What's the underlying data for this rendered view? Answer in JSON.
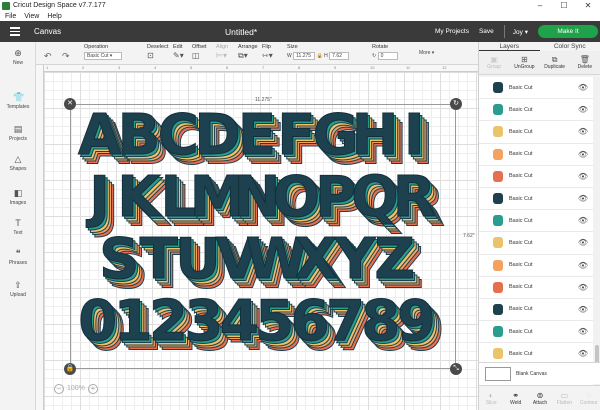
{
  "window": {
    "title": "Cricut Design Space  v7.7.177",
    "controls": [
      "–",
      "☐",
      "✕"
    ]
  },
  "menu": [
    "File",
    "View",
    "Help"
  ],
  "header": {
    "section": "Canvas",
    "doc_title": "Untitled*",
    "my_projects": "My Projects",
    "save": "Save",
    "user": "Joy",
    "user_chevron": "▾",
    "make_it": "Make It"
  },
  "toolbar": {
    "undo": "↶",
    "redo": "↷",
    "operation_label": "Operation",
    "operation_value": "Basic Cut",
    "deselect": "Deselect",
    "edit": "Edit",
    "offset": "Offset",
    "align": "Align",
    "arrange": "Arrange",
    "flip": "Flip",
    "size": "Size",
    "w_label": "W",
    "w_value": "11.275",
    "h_label": "H",
    "h_value": "7.62",
    "rotate": "Rotate",
    "rotate_value": "0",
    "more": "More"
  },
  "leftnav": [
    {
      "label": "New",
      "icon": "plus-icon",
      "glyph": "⊕"
    },
    {
      "label": "Templates",
      "icon": "shirt-icon",
      "glyph": "👕"
    },
    {
      "label": "Projects",
      "icon": "projects-icon",
      "glyph": "▤"
    },
    {
      "label": "Shapes",
      "icon": "shapes-icon",
      "glyph": "△"
    },
    {
      "label": "Images",
      "icon": "images-icon",
      "glyph": "◧"
    },
    {
      "label": "Text",
      "icon": "text-icon",
      "glyph": "T"
    },
    {
      "label": "Phrases",
      "icon": "phrases-icon",
      "glyph": "❝"
    },
    {
      "label": "Upload",
      "icon": "upload-icon",
      "glyph": "⇪"
    }
  ],
  "canvas": {
    "ruler_ticks": [
      "1",
      "2",
      "3",
      "4",
      "5",
      "6",
      "7",
      "8",
      "9",
      "10",
      "11",
      "12"
    ],
    "width_dim": "11.275\"",
    "height_dim": "7.62\"",
    "zoom": "100%",
    "rows": [
      "ABCDEFGHI",
      "JKLMNOPQR",
      "STUVWXYZ",
      "0123456789"
    ],
    "letter_color": "#1e4150",
    "shadow_colors": [
      "#2a9d8f",
      "#e9c46a",
      "#f4a261",
      "#e76f51"
    ]
  },
  "panel": {
    "tabs": [
      "Layers",
      "Color Sync"
    ],
    "tools": [
      {
        "label": "Group",
        "icon": "group-icon",
        "glyph": "▣",
        "enabled": false
      },
      {
        "label": "UnGroup",
        "icon": "ungroup-icon",
        "glyph": "⊞",
        "enabled": true
      },
      {
        "label": "Duplicate",
        "icon": "duplicate-icon",
        "glyph": "⧉",
        "enabled": true
      },
      {
        "label": "Delete",
        "icon": "trash-icon",
        "glyph": "🗑",
        "enabled": true
      }
    ],
    "layers": [
      {
        "name": "Basic Cut",
        "color": "#1e4150"
      },
      {
        "name": "Basic Cut",
        "color": "#2a9d8f"
      },
      {
        "name": "Basic Cut",
        "color": "#e9c46a"
      },
      {
        "name": "Basic Cut",
        "color": "#f4a261"
      },
      {
        "name": "Basic Cut",
        "color": "#e76f51"
      },
      {
        "name": "Basic Cut",
        "color": "#1e4150"
      },
      {
        "name": "Basic Cut",
        "color": "#2a9d8f"
      },
      {
        "name": "Basic Cut",
        "color": "#e9c46a"
      },
      {
        "name": "Basic Cut",
        "color": "#f4a261"
      },
      {
        "name": "Basic Cut",
        "color": "#e76f51"
      },
      {
        "name": "Basic Cut",
        "color": "#1e4150"
      },
      {
        "name": "Basic Cut",
        "color": "#2a9d8f"
      },
      {
        "name": "Basic Cut",
        "color": "#e9c46a"
      },
      {
        "name": "Basic Cut",
        "color": "#f4a261"
      }
    ],
    "blank_canvas": "Blank Canvas",
    "bottom": [
      {
        "label": "Slice",
        "icon": "slice-icon",
        "glyph": "◐",
        "enabled": false
      },
      {
        "label": "Weld",
        "icon": "weld-icon",
        "glyph": "⚭",
        "enabled": true
      },
      {
        "label": "Attach",
        "icon": "attach-icon",
        "glyph": "⊚",
        "enabled": true
      },
      {
        "label": "Flatten",
        "icon": "flatten-icon",
        "glyph": "▭",
        "enabled": false
      },
      {
        "label": "Contour",
        "icon": "contour-icon",
        "glyph": "◌",
        "enabled": false
      }
    ]
  }
}
